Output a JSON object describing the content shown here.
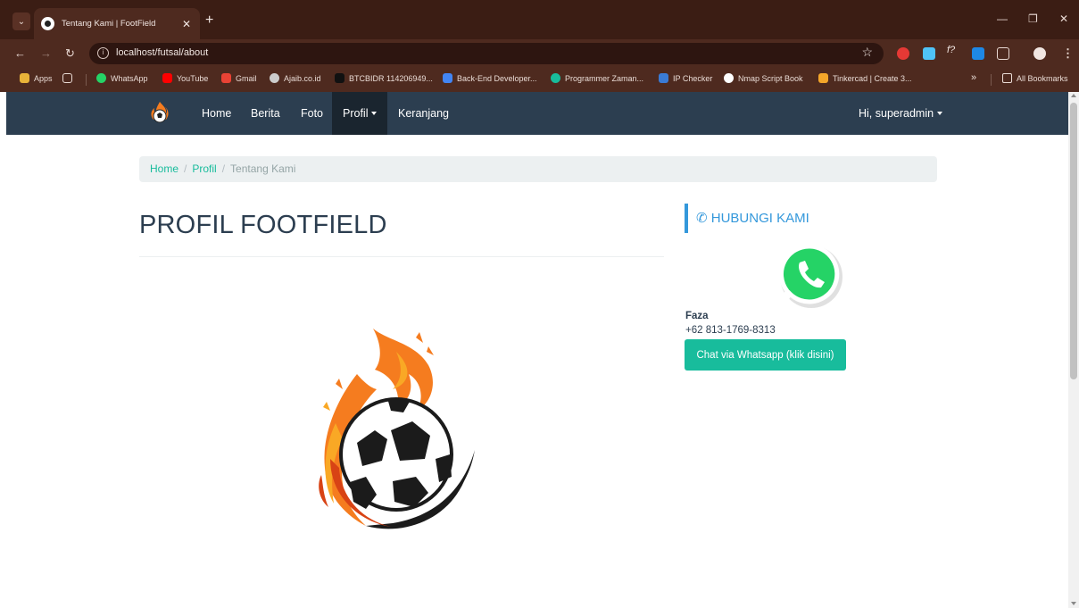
{
  "browser": {
    "tab_title": "Tentang Kami | FootField",
    "url": "localhost/futsal/about",
    "bookmarks": [
      {
        "label": "Apps",
        "color": "#e8b339"
      },
      {
        "label": "WhatsApp",
        "color": "#25d366"
      },
      {
        "label": "YouTube",
        "color": "#ff0000"
      },
      {
        "label": "Gmail",
        "color": "#ea4335"
      },
      {
        "label": "Ajaib.co.id",
        "color": "#cccccc"
      },
      {
        "label": "BTCBIDR 114206949...",
        "color": "#111111"
      },
      {
        "label": "Back-End Developer...",
        "color": "#4285f4"
      },
      {
        "label": "Programmer Zaman...",
        "color": "#18bc9c"
      },
      {
        "label": "IP Checker",
        "color": "#3a7bd5"
      },
      {
        "label": "Nmap Script Book",
        "color": "#ffffff"
      },
      {
        "label": "Tinkercad | Create 3...",
        "color": "#f4a62a"
      }
    ],
    "bookmarks_more": "»",
    "all_bookmarks": "All Bookmarks"
  },
  "navbar": {
    "items": [
      "Home",
      "Berita",
      "Foto",
      "Profil",
      "Keranjang"
    ],
    "active_item": "Profil",
    "user_menu": "Hi, superadmin",
    "color": "#2c3e50"
  },
  "breadcrumb": {
    "home": "Home",
    "profil": "Profil",
    "current": "Tentang Kami",
    "separator": "/"
  },
  "main": {
    "title": "PROFIL FOOTFIELD"
  },
  "sidebar": {
    "heading": "HUBUNGI KAMI",
    "contact_name": "Faza",
    "contact_phone": "+62 813-1769-8313",
    "button_label": "Chat via Whatsapp (klik disini)",
    "accent": "#18bc9c"
  }
}
